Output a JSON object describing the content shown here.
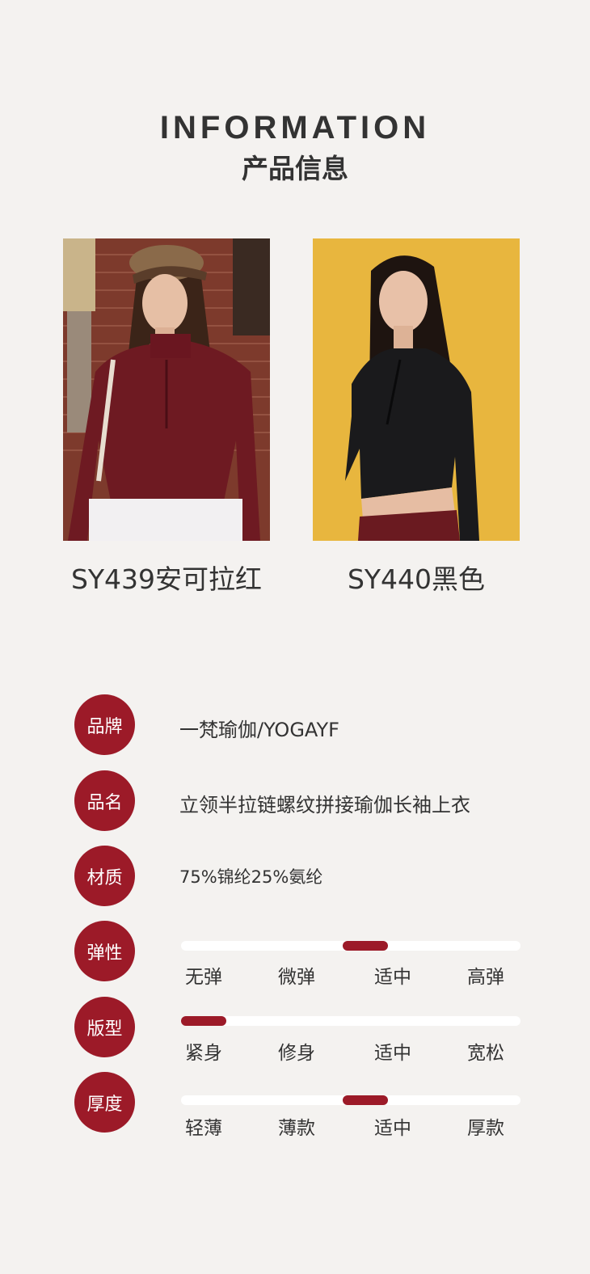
{
  "header": {
    "title_en": "INFORMATION",
    "title_cn": "产品信息"
  },
  "products": [
    {
      "caption": "SY439安可拉红",
      "color": "#7a1e2a"
    },
    {
      "caption": "SY440黑色",
      "color": "#1c1c1e"
    }
  ],
  "specs": {
    "brand": {
      "label": "品牌",
      "value": "一梵瑜伽/YOGAYF"
    },
    "name": {
      "label": "品名",
      "value": "立领半拉链螺纹拼接瑜伽长袖上衣"
    },
    "material": {
      "label": "材质",
      "value": "75%锦纶25%氨纶"
    }
  },
  "ratings": [
    {
      "label": "弹性",
      "options": [
        "无弹",
        "微弹",
        "适中",
        "高弹"
      ],
      "selected": "适中",
      "level": 0.55
    },
    {
      "label": "版型",
      "options": [
        "紧身",
        "修身",
        "适中",
        "宽松"
      ],
      "selected": "紧身",
      "level": 0.0
    },
    {
      "label": "厚度",
      "options": [
        "轻薄",
        "薄款",
        "适中",
        "厚款"
      ],
      "selected": "适中",
      "level": 0.55
    }
  ],
  "colors": {
    "accent": "#9c1a28",
    "background": "#f4f2f0",
    "text": "#333333"
  }
}
